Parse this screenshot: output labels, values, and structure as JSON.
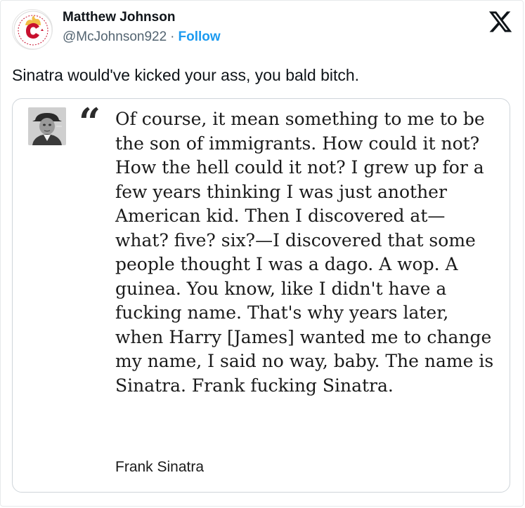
{
  "tweet": {
    "author_name": "Matthew Johnson",
    "handle": "@McJohnson922",
    "separator": "·",
    "follow_label": "Follow",
    "text": "Sinatra would've kicked your ass, you bald bitch.",
    "logo_icon": "x-logo-icon",
    "avatar_icon": "flaming-c-logo-icon"
  },
  "quote": {
    "mark": "“",
    "text": "Of course, it mean something to me to be the son of immigrants. How could it not? How the hell could it not? I grew up for a few years thinking I was just another American kid. Then I discovered at—what? five? six?—I discovered that some people thought I was a dago. A wop. A guinea. You know, like I didn't have a fucking name. That's why years later, when Harry [James] wanted me to change my name, I said no way, baby. The name is Sinatra. Frank fucking Sinatra.",
    "author": "Frank Sinatra",
    "photo_icon": "frank-sinatra-portrait"
  },
  "colors": {
    "text": "#0f1419",
    "secondary": "#536471",
    "link": "#1d9bf0",
    "avatar_red": "#c8102e",
    "avatar_gold": "#f1be48"
  }
}
